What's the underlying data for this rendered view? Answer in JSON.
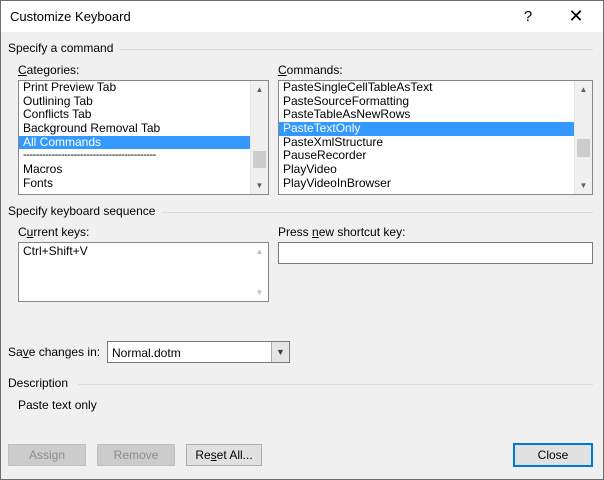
{
  "window": {
    "title": "Customize Keyboard",
    "help_glyph": "?",
    "close_glyph": "✕"
  },
  "command_section": {
    "title": "Specify a command",
    "categories_label_prefix": "",
    "categories_label_key": "C",
    "categories_label_rest": "ategories:",
    "categories": [
      "Print Preview Tab",
      "Outlining Tab",
      "Conflicts Tab",
      "Background Removal Tab",
      "All Commands",
      "------------------------------------------",
      "Macros",
      "Fonts"
    ],
    "categories_selected_index": 4,
    "commands_label_prefix": "",
    "commands_label_key": "C",
    "commands_label_rest": "ommands:",
    "commands": [
      "PasteSingleCellTableAsText",
      "PasteSourceFormatting",
      "PasteTableAsNewRows",
      "PasteTextOnly",
      "PasteXmlStructure",
      "PauseRecorder",
      "PlayVideo",
      "PlayVideoInBrowser"
    ],
    "commands_selected_index": 3
  },
  "keyboard_section": {
    "title": "Specify keyboard sequence",
    "current_keys_label_prefix": "C",
    "current_keys_label_key": "u",
    "current_keys_label_rest": "rrent keys:",
    "current_keys": [
      "Ctrl+Shift+V"
    ],
    "new_key_label_prefix": "Press ",
    "new_key_label_key": "n",
    "new_key_label_rest": "ew shortcut key:",
    "new_key_value": ""
  },
  "save": {
    "label_prefix": "Sa",
    "label_key": "v",
    "label_rest": "e changes in:",
    "value": "Normal.dotm"
  },
  "description": {
    "title": "Description",
    "text": "Paste text only"
  },
  "buttons": {
    "assign": "Assign",
    "remove": "Remove",
    "reset_prefix": "Re",
    "reset_key": "s",
    "reset_rest": "et All...",
    "close": "Close"
  },
  "icons": {
    "up": "▲",
    "down": "▼",
    "dropdown": "▼"
  }
}
